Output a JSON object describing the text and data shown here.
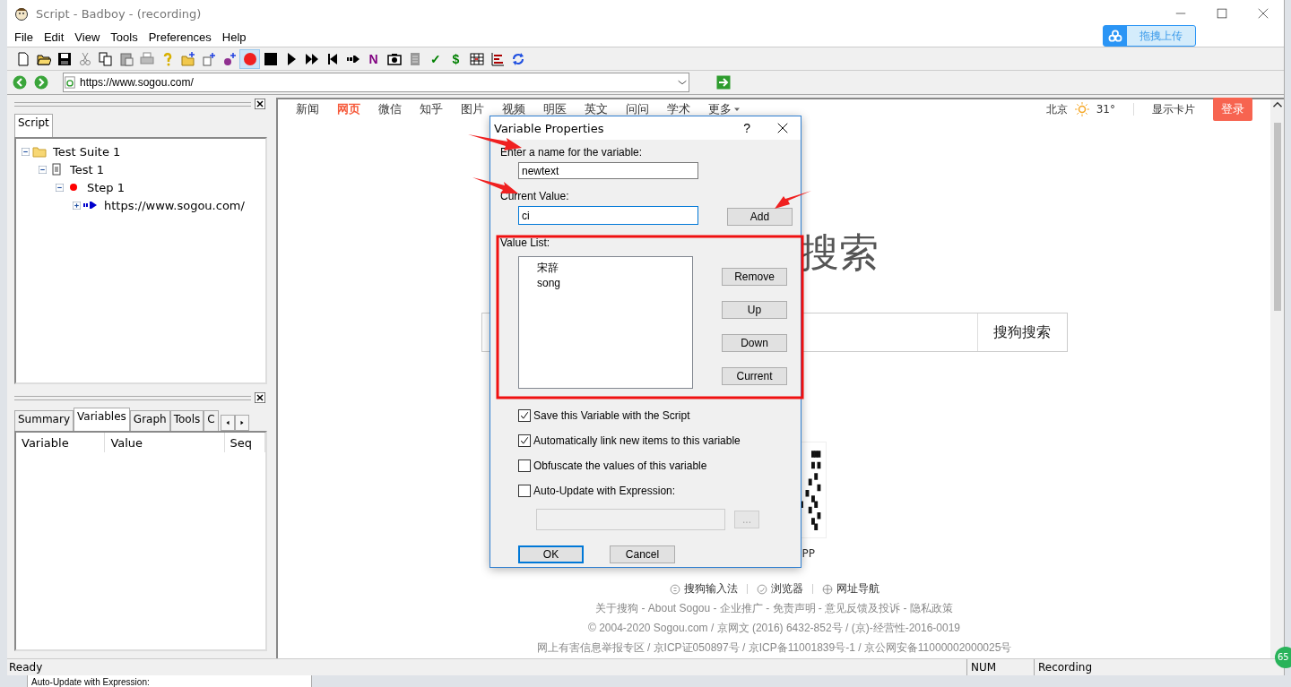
{
  "window": {
    "title": "Script - Badboy - (recording)"
  },
  "menu": [
    "File",
    "Edit",
    "View",
    "Tools",
    "Preferences",
    "Help"
  ],
  "upload_badge": {
    "label": "拖拽上传"
  },
  "toolbar": [
    {
      "kind": "new",
      "selected": false
    },
    {
      "kind": "open",
      "selected": false
    },
    {
      "kind": "save",
      "selected": false
    },
    {
      "kind": "cut",
      "selected": false
    },
    {
      "kind": "copy",
      "selected": false
    },
    {
      "kind": "paste",
      "selected": false
    },
    {
      "kind": "print",
      "selected": false
    },
    {
      "kind": "help",
      "selected": false
    },
    {
      "kind": "folder-add",
      "selected": false
    },
    {
      "kind": "item-add",
      "selected": false
    },
    {
      "kind": "step-add",
      "selected": false
    },
    {
      "kind": "record",
      "selected": true
    },
    {
      "kind": "stop",
      "selected": false
    },
    {
      "kind": "play",
      "selected": false
    },
    {
      "kind": "fast-forward",
      "selected": false
    },
    {
      "kind": "rewind",
      "selected": false
    },
    {
      "kind": "run",
      "selected": false
    },
    {
      "kind": "glyph",
      "glyph": "N",
      "color": "#800080",
      "selected": false
    },
    {
      "kind": "camera",
      "selected": false
    },
    {
      "kind": "page",
      "selected": false
    },
    {
      "kind": "glyph",
      "glyph": "✓",
      "color": "#008000",
      "selected": false
    },
    {
      "kind": "glyph",
      "glyph": "$",
      "color": "#008000",
      "selected": false
    },
    {
      "kind": "table",
      "selected": false
    },
    {
      "kind": "tree-chart",
      "selected": false
    },
    {
      "kind": "refresh",
      "selected": false
    }
  ],
  "address_bar": {
    "url": "https://www.sogou.com/"
  },
  "script_panel": {
    "tabs": [
      {
        "label": "Script",
        "selected": true
      }
    ],
    "tree": [
      {
        "label": "Test Suite 1",
        "kind": "suite",
        "expanded": true,
        "children": [
          {
            "label": "Test 1",
            "kind": "test",
            "expanded": true,
            "children": [
              {
                "label": "Step 1",
                "kind": "step",
                "expanded": true,
                "children": [
                  {
                    "label": "https://www.sogou.com/",
                    "kind": "request",
                    "expanded": false
                  }
                ]
              }
            ]
          }
        ]
      }
    ]
  },
  "info_panel": {
    "tabs": [
      {
        "label": "Summary",
        "selected": false
      },
      {
        "label": "Variables",
        "selected": true
      },
      {
        "label": "Graph",
        "selected": false
      },
      {
        "label": "Tools",
        "selected": false
      },
      {
        "label": "C",
        "selected": false
      }
    ],
    "columns": [
      "Variable",
      "Value",
      "Seq"
    ]
  },
  "browser": {
    "nav": [
      {
        "label": "新闻",
        "selected": false
      },
      {
        "label": "网页",
        "selected": true
      },
      {
        "label": "微信",
        "selected": false
      },
      {
        "label": "知乎",
        "selected": false
      },
      {
        "label": "图片",
        "selected": false
      },
      {
        "label": "视频",
        "selected": false
      },
      {
        "label": "明医",
        "selected": false
      },
      {
        "label": "英文",
        "selected": false
      },
      {
        "label": "问问",
        "selected": false
      },
      {
        "label": "学术",
        "selected": false
      },
      {
        "label": "更多",
        "selected": false
      }
    ],
    "city": "北京",
    "temperature": "31°",
    "show_cards": "显示卡片",
    "login": "登录",
    "logo": "搜索",
    "search_button": "搜狗搜索",
    "app_label": "PP",
    "footer_links": [
      "搜狗输入法",
      "浏览器",
      "网址导航"
    ],
    "footer_lines": [
      "关于搜狗 - About Sogou - 企业推广 - 免责声明 - 意见反馈及投诉 - 隐私政策",
      "© 2004-2020 Sogou.com / 京网文 (2016) 6432-852号 / (京)-经营性-2016-0019",
      "网上有害信息举报专区 / 京ICP证050897号 / 京ICP备11001839号-1 / 京公网安备11000002000025号"
    ]
  },
  "dialog": {
    "title": "Variable Properties",
    "help": "?",
    "name_label": "Enter a name for the variable:",
    "name_value": "newtext",
    "current_label": "Current Value:",
    "current_value": "ci",
    "add": "Add",
    "list_label": "Value List:",
    "values": [
      "宋辞",
      "song"
    ],
    "buttons": [
      "Remove",
      "Up",
      "Down",
      "Current"
    ],
    "options": [
      {
        "label": "Save this Variable with the Script",
        "checked": true
      },
      {
        "label": "Automatically link new items to this variable",
        "checked": true
      },
      {
        "label": "Obfuscate the values of this variable",
        "checked": false
      },
      {
        "label": "Auto-Update with Expression:",
        "checked": false
      }
    ],
    "expression": {
      "disabled": true
    },
    "browse": {
      "label": "...",
      "disabled": true
    },
    "actions": [
      {
        "label": "OK",
        "default": true
      },
      {
        "label": "Cancel",
        "default": false
      }
    ]
  },
  "status_bar": {
    "message": "Ready",
    "num": "NUM",
    "mode": "Recording"
  },
  "side_badge": {
    "label": "65"
  },
  "background_window": {
    "text": "Auto-Update with Expression:"
  }
}
